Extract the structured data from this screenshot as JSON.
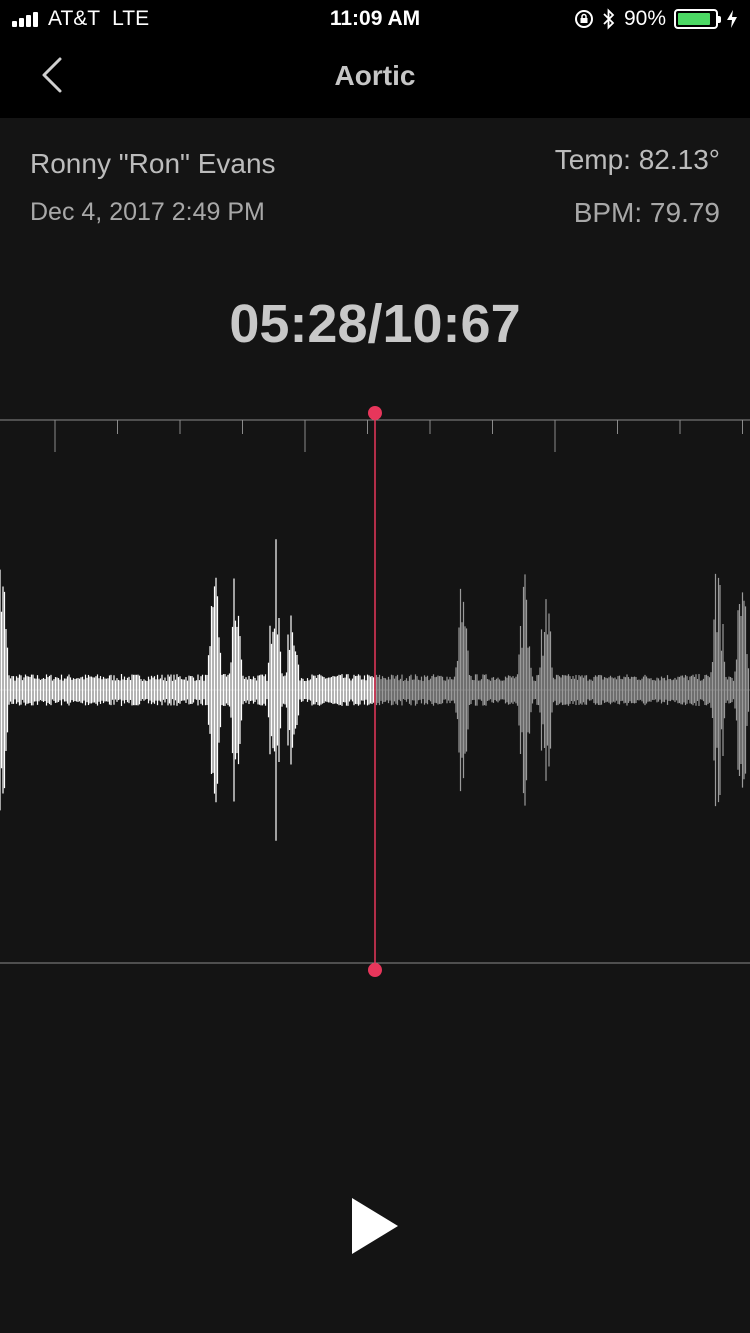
{
  "status_bar": {
    "carrier": "AT&T",
    "network": "LTE",
    "time": "11:09 AM",
    "battery_percent": "90%",
    "battery_level": 0.9,
    "icons": [
      "signal-icon",
      "orientation-lock-icon",
      "bluetooth-icon",
      "battery-icon",
      "charging-icon"
    ]
  },
  "nav": {
    "title": "Aortic",
    "back_icon": "chevron-left-icon"
  },
  "recording": {
    "patient_name": "Ronny \"Ron\" Evans",
    "date": "Dec 4, 2017 2:49 PM",
    "temp": "Temp: 82.13°",
    "bpm": "BPM: 79.79",
    "time_readout": "05:28/10:67",
    "playback_progress": 0.5
  },
  "colors": {
    "background": "#141414",
    "playhead": "#e8365b",
    "waveform_played": "#ffffff",
    "waveform_unplayed": "#9a9a9a",
    "battery": "#4cd964"
  },
  "controls": {
    "play_icon": "play-icon"
  }
}
